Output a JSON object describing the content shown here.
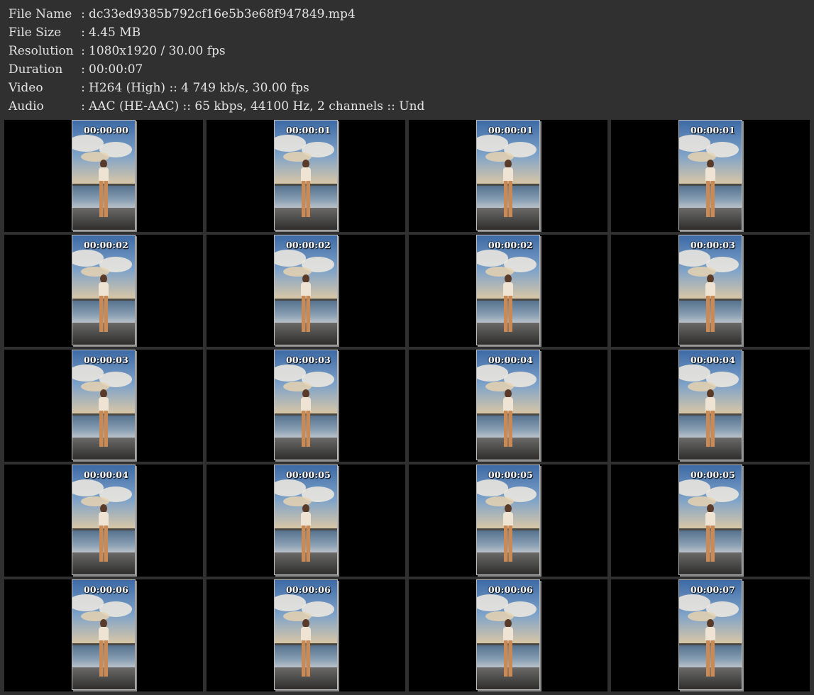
{
  "info": [
    {
      "key": "File Name",
      "sep": ":",
      "value": "dc33ed9385b792cf16e5b3e68f947849.mp4"
    },
    {
      "key": "File Size",
      "sep": ":",
      "value": "4.45 MB"
    },
    {
      "key": "Resolution",
      "sep": ":",
      "value": "1080x1920 / 30.00 fps"
    },
    {
      "key": "Duration",
      "sep": ":",
      "value": "00:00:07"
    },
    {
      "key": "Video",
      "sep": ":",
      "value": "H264 (High) :: 4 749 kb/s, 30.00 fps"
    },
    {
      "key": "Audio",
      "sep": ":",
      "value": "AAC (HE-AAC) :: 65 kbps, 44100 Hz, 2 channels :: Und"
    }
  ],
  "thumbnails": [
    {
      "timestamp": "00:00:00"
    },
    {
      "timestamp": "00:00:01"
    },
    {
      "timestamp": "00:00:01"
    },
    {
      "timestamp": "00:00:01"
    },
    {
      "timestamp": "00:00:02"
    },
    {
      "timestamp": "00:00:02"
    },
    {
      "timestamp": "00:00:02"
    },
    {
      "timestamp": "00:00:03"
    },
    {
      "timestamp": "00:00:03"
    },
    {
      "timestamp": "00:00:03"
    },
    {
      "timestamp": "00:00:04"
    },
    {
      "timestamp": "00:00:04"
    },
    {
      "timestamp": "00:00:04"
    },
    {
      "timestamp": "00:00:05"
    },
    {
      "timestamp": "00:00:05"
    },
    {
      "timestamp": "00:00:05"
    },
    {
      "timestamp": "00:00:06"
    },
    {
      "timestamp": "00:00:06"
    },
    {
      "timestamp": "00:00:06"
    },
    {
      "timestamp": "00:00:07"
    }
  ],
  "colors": {
    "background": "#303030",
    "text": "#e4e4e4",
    "cell_background": "#000000",
    "timestamp": "#ffffff"
  }
}
